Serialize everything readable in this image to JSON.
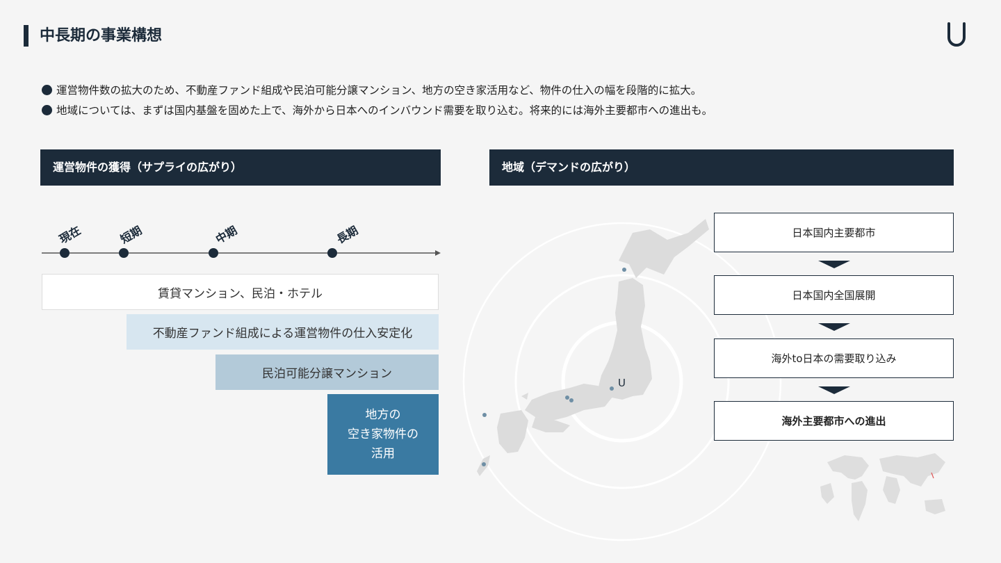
{
  "header": {
    "title": "中長期の事業構想"
  },
  "bullets": [
    "運営物件数の拡大のため、不動産ファンド組成や民泊可能分譲マンション、地方の空き家活用など、物件の仕入の幅を段階的に拡大。",
    "地域については、まずは国内基盤を固めた上で、海外から日本へのインバウンド需要を取り込む。将来的には海外主要都市への進出も。"
  ],
  "left_panel": {
    "header": "運営物件の獲得（サプライの広がり）",
    "timeline": [
      "現在",
      "短期",
      "中期",
      "長期"
    ],
    "bars": [
      "賃貸マンション、民泊・ホテル",
      "不動産ファンド組成による運営物件の仕入安定化",
      "民泊可能分譲マンション"
    ],
    "bar4_lines": [
      "地方の",
      "空き家物件の",
      "活用"
    ]
  },
  "right_panel": {
    "header": "地域（デマンドの広がり）",
    "map_logo": "U",
    "steps": [
      "日本国内主要都市",
      "日本国内全国展開",
      "海外to日本の需要取り込み",
      "海外主要都市への進出"
    ]
  },
  "colors": {
    "navy": "#1c2b3a",
    "light_blue": "#d7e6f0",
    "mid_blue": "#b3cad9",
    "blue": "#3a7aa2"
  }
}
